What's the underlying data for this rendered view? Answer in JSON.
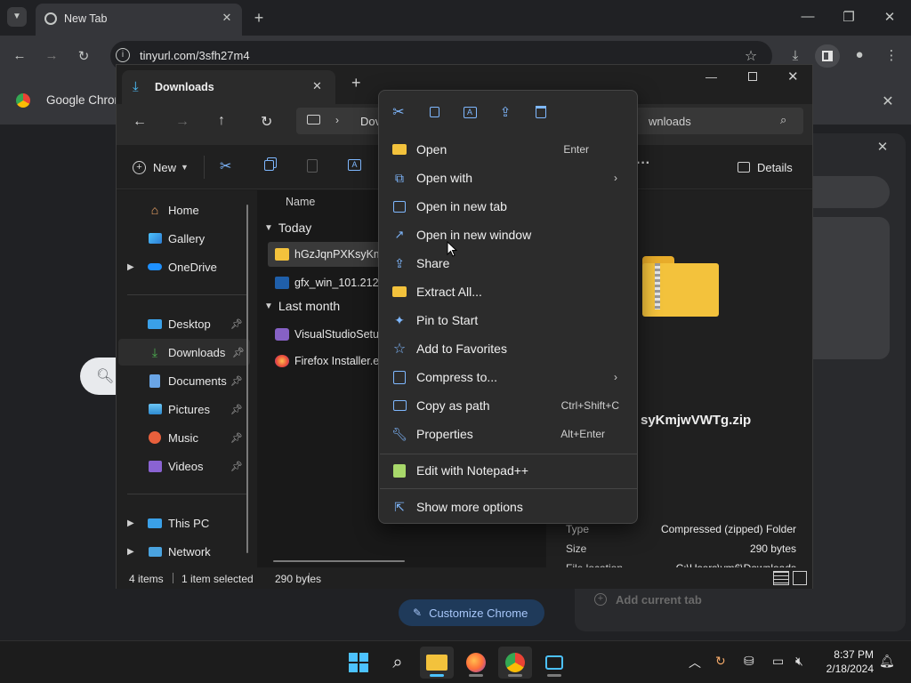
{
  "chrome": {
    "tab_title": "New Tab",
    "url": "tinyurl.com/3sfh27m4",
    "infobar_label": "Google Chrom",
    "customize_button": "Customize Chrome",
    "add_current_tab": "Add current tab"
  },
  "explorer": {
    "tab_title": "Downloads",
    "address_fragment": "Dov",
    "search_fragment": "wnloads",
    "toolbar": {
      "new_label": "New",
      "details_label": "Details"
    },
    "nav": {
      "home": "Home",
      "gallery": "Gallery",
      "onedrive": "OneDrive",
      "desktop": "Desktop",
      "downloads": "Downloads",
      "documents": "Documents",
      "pictures": "Pictures",
      "music": "Music",
      "videos": "Videos",
      "thispc": "This PC",
      "network": "Network"
    },
    "files": {
      "column_name": "Name",
      "group_today": "Today",
      "group_last_month": "Last month",
      "items": [
        "hGzJqnPXKsyKmjv",
        "gfx_win_101.2127.e",
        "VisualStudioSetup",
        "Firefox Installer.exe"
      ]
    },
    "details": {
      "filename": "syKmjwVWTg.zip",
      "type_label": "Type",
      "type_value": "Compressed (zipped) Folder",
      "size_label": "Size",
      "size_value": "290 bytes",
      "location_label": "File location",
      "location_value": "C:\\Users\\vm6\\Downloads"
    },
    "status": {
      "items": "4 items",
      "selected": "1 item selected",
      "size": "290 bytes"
    }
  },
  "context_menu": {
    "open": {
      "label": "Open",
      "shortcut": "Enter"
    },
    "open_with": {
      "label": "Open with"
    },
    "open_new_tab": {
      "label": "Open in new tab"
    },
    "open_new_window": {
      "label": "Open in new window"
    },
    "share": {
      "label": "Share"
    },
    "extract_all": {
      "label": "Extract All..."
    },
    "pin_to_start": {
      "label": "Pin to Start"
    },
    "add_favorites": {
      "label": "Add to Favorites"
    },
    "compress_to": {
      "label": "Compress to..."
    },
    "copy_as_path": {
      "label": "Copy as path",
      "shortcut": "Ctrl+Shift+C"
    },
    "properties": {
      "label": "Properties",
      "shortcut": "Alt+Enter"
    },
    "edit_notepad": {
      "label": "Edit with Notepad++"
    },
    "show_more": {
      "label": "Show more options"
    }
  },
  "taskbar": {
    "time": "8:37 PM",
    "date": "2/18/2024"
  },
  "colors": {
    "accent": "#4cc2ff",
    "folder": "#f3c23c"
  }
}
